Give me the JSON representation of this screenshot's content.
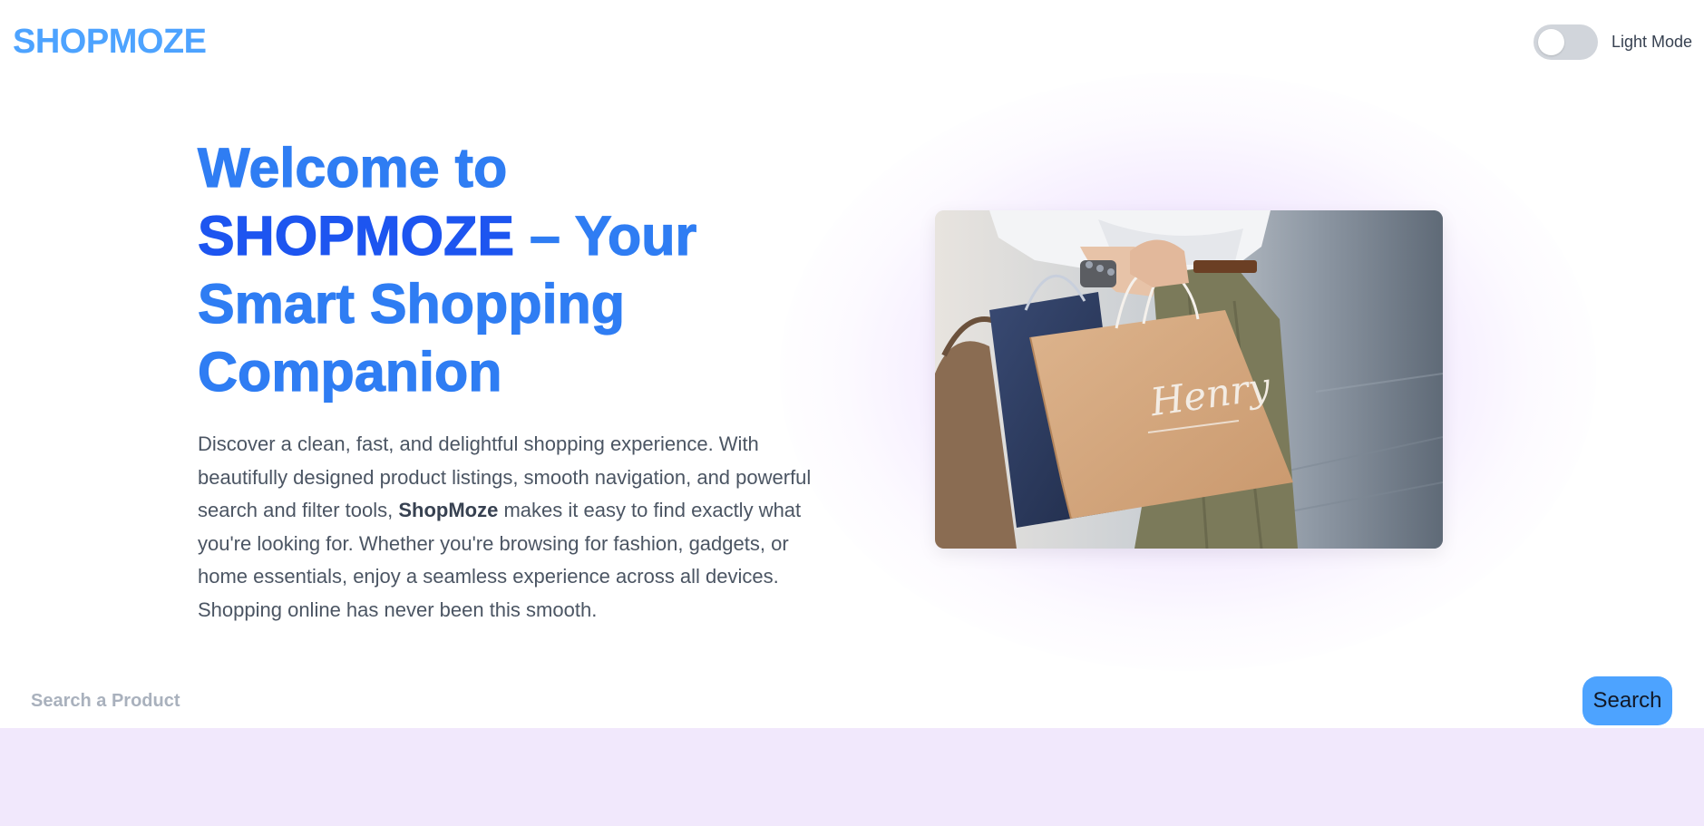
{
  "header": {
    "logo": "SHOPMOZE",
    "theme_toggle_label": "Light Mode",
    "theme_toggle_on": false
  },
  "hero": {
    "title_part1": "Welcome to ",
    "title_brand": "SHOPMOZE",
    "title_part2": " – Your Smart Shopping Companion",
    "description_before": "Discover a clean, fast, and delightful shopping experience. With beautifully designed product listings, smooth navigation, and powerful search and filter tools, ",
    "description_brand": "ShopMoze",
    "description_after": " makes it easy to find exactly what you're looking for. Whether you're browsing for fashion, gadgets, or home essentials, enjoy a seamless experience across all devices. Shopping online has never been this smooth.",
    "image_bag_text": "Henry"
  },
  "search": {
    "placeholder": "Search a Product",
    "value": "",
    "button_label": "Search"
  },
  "colors": {
    "accent": "#4da3ff",
    "title_blue": "#2f7df3",
    "brand_blue": "#1d55f0",
    "band_lavender": "#f1e8fc"
  }
}
